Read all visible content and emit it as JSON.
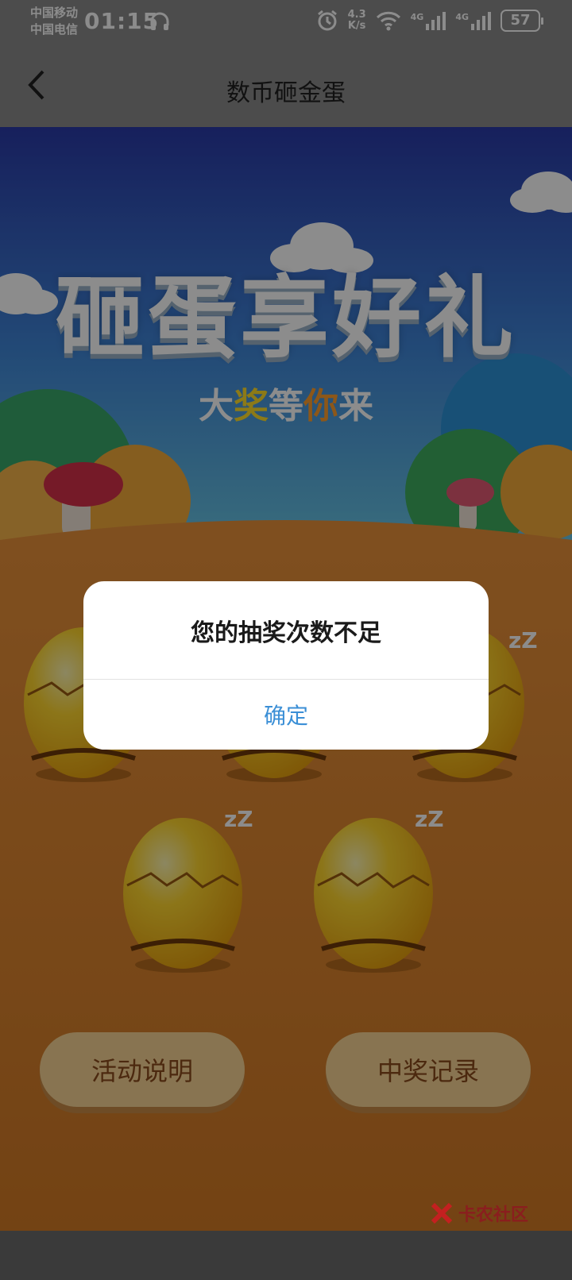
{
  "status_bar": {
    "carrier_1": "中国移动",
    "carrier_2": "中国电信",
    "time": "01:15",
    "net_speed_value": "4.3",
    "net_speed_unit": "K/s",
    "signal_1_label": "4G",
    "signal_2_label": "4G",
    "battery": "57",
    "icons": [
      "headphone-icon",
      "alarm-icon",
      "wifi-icon",
      "signal-icon",
      "battery-icon"
    ]
  },
  "nav": {
    "title": "数币砸金蛋",
    "back_icon": "chevron-left-icon"
  },
  "banner": {
    "headline": "砸蛋享好礼",
    "tagline_parts": [
      "大",
      "奖",
      "等",
      "你",
      "来"
    ]
  },
  "eggs": {
    "count": 5,
    "sleep_marks": "zZ"
  },
  "buttons": {
    "rules_label": "活动说明",
    "records_label": "中奖记录"
  },
  "dialog": {
    "message": "您的抽奖次数不足",
    "confirm_label": "确定"
  },
  "watermark": {
    "text": "卡农社区"
  },
  "colors": {
    "sky_top": "#2a3aa8",
    "ground": "#e8913a",
    "egg": "#f3c21e",
    "button_bg": "#f7d394",
    "button_text": "#8a4b1c",
    "dialog_confirm": "#3b8fd6"
  }
}
